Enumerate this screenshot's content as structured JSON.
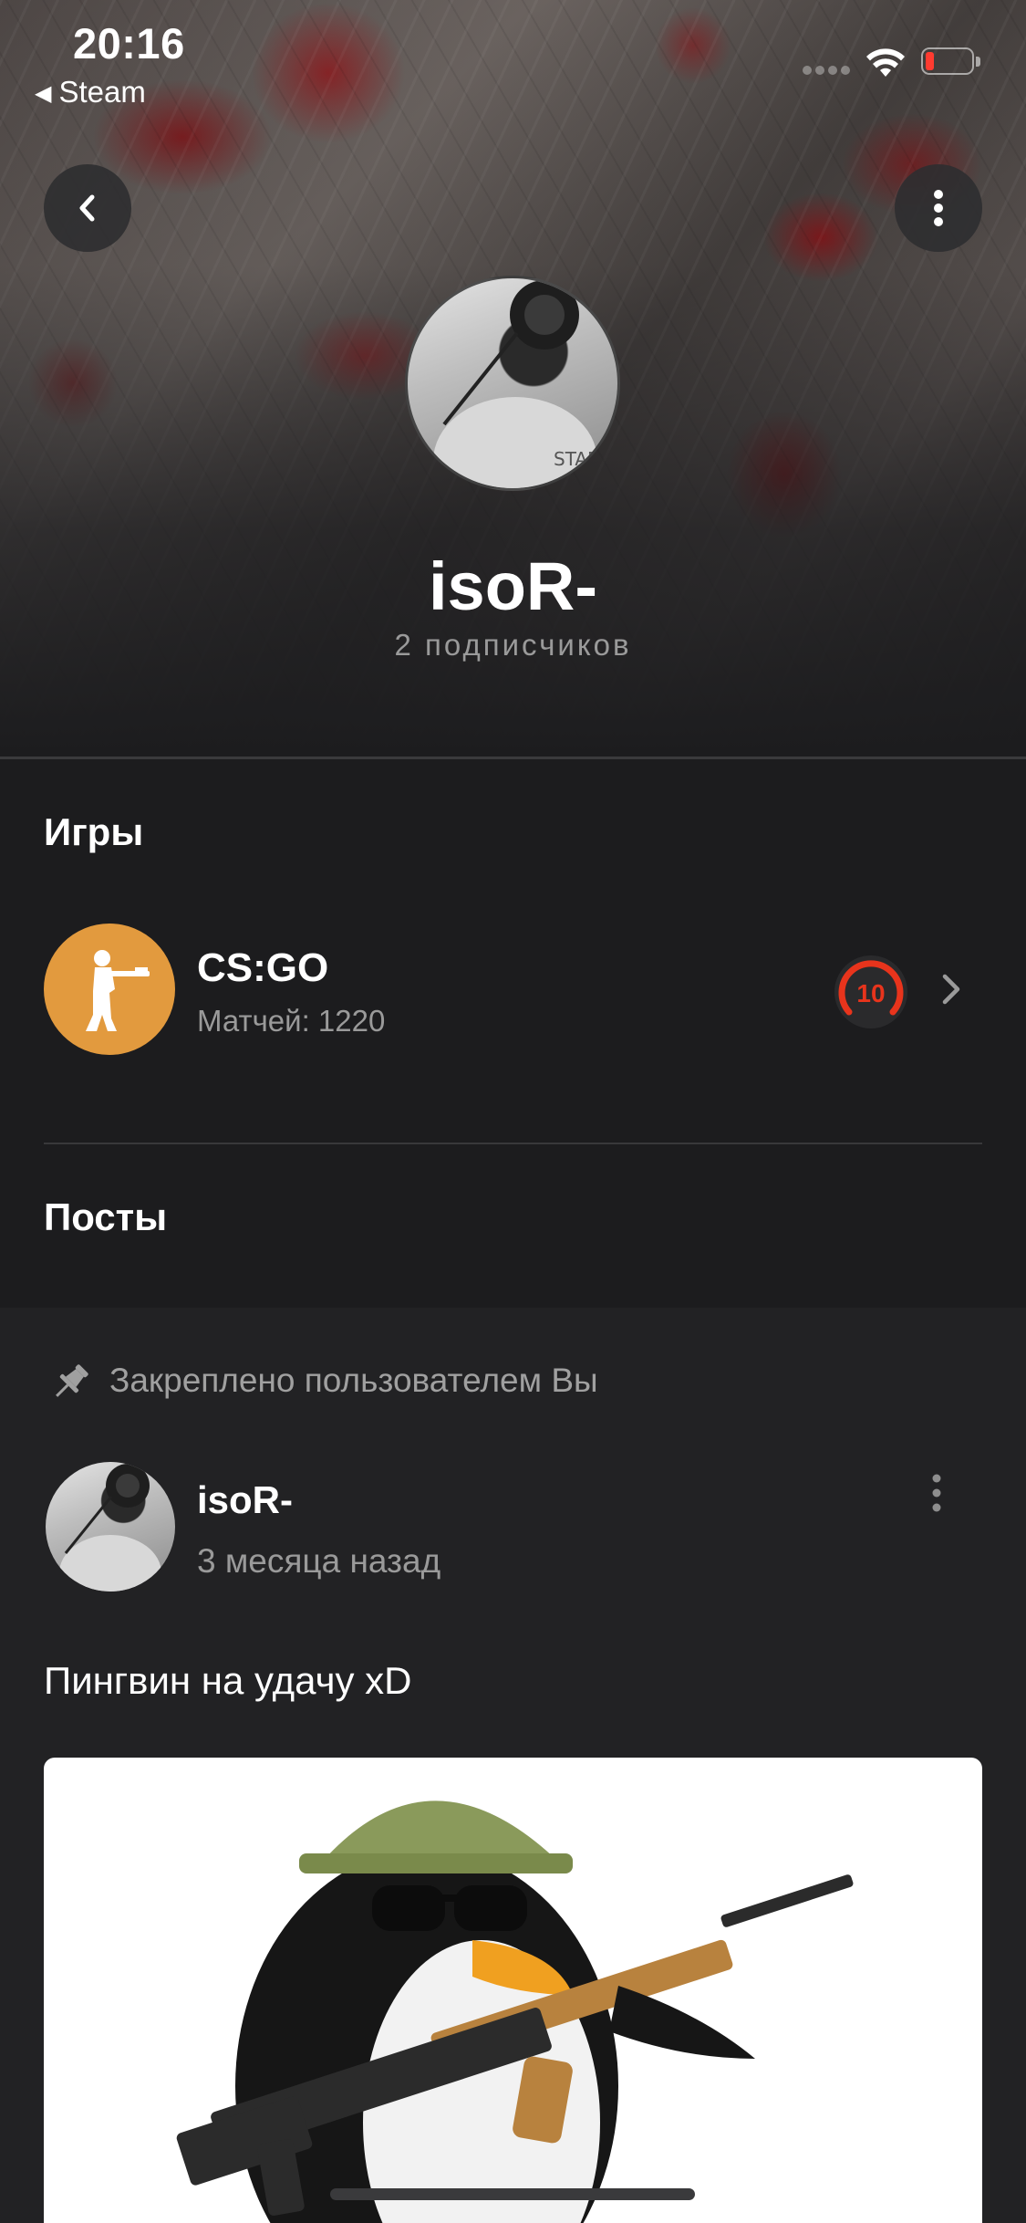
{
  "status_bar": {
    "time": "20:16",
    "back_app": "Steam",
    "back_arrow": "◀"
  },
  "header": {
    "back_icon": "chevron-left-icon",
    "more_icon": "vertical-ellipsis-icon"
  },
  "profile": {
    "name": "isoR-",
    "followers": "2 подписчиков"
  },
  "games": {
    "title": "Игры",
    "items": [
      {
        "name": "CS:GO",
        "matches": "Матчей: 1220",
        "level": "10",
        "icon_color": "#e29a3e",
        "level_color": "#e8341c"
      }
    ]
  },
  "posts": {
    "title": "Посты",
    "pinned_label": "Закреплено пользователем Вы",
    "items": [
      {
        "author": "isoR-",
        "time": "3 месяца назад",
        "text": "Пингвин на удачу xD"
      }
    ]
  }
}
